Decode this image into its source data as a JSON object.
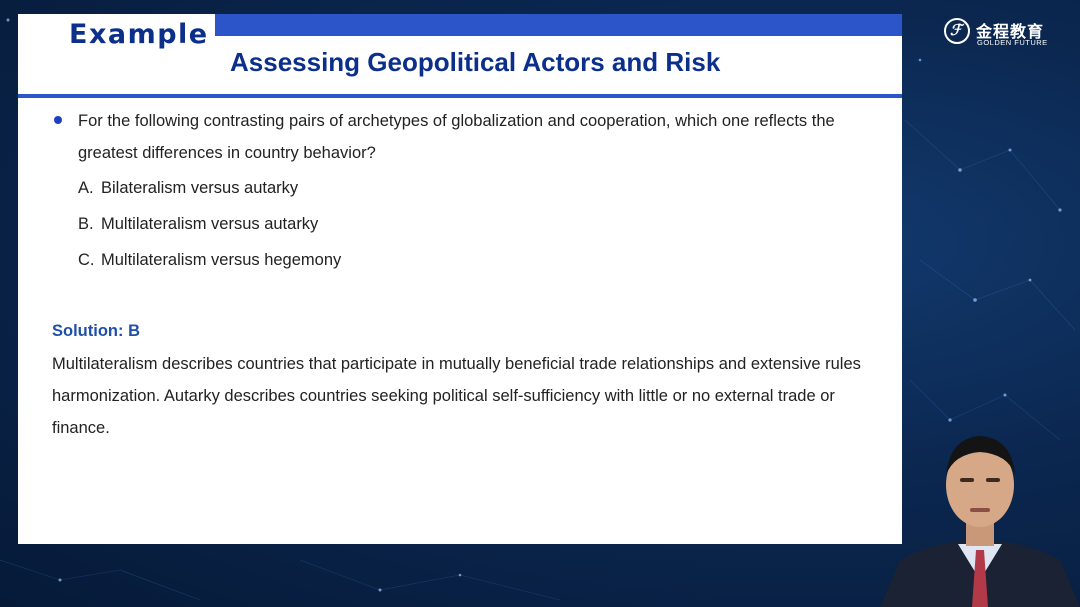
{
  "slide": {
    "tab_label": "Example",
    "title": "Assessing Geopolitical Actors and Risk",
    "question_lines": [
      "For the following contrasting pairs of archetypes of globalization and cooperation, which one reflects the",
      "greatest differences in country behavior?"
    ],
    "options": [
      {
        "letter": "A.",
        "text": "Bilateralism versus autarky"
      },
      {
        "letter": "B.",
        "text": "Multilateralism versus autarky"
      },
      {
        "letter": "C.",
        "text": "Multilateralism versus hegemony"
      }
    ],
    "solution_label": "Solution: B",
    "solution_lines": [
      "Multilateralism describes countries that participate in mutually beneficial trade relationships and extensive rules",
      "harmonization. Autarky describes countries seeking political self-sufficiency with little or no external trade or",
      "finance."
    ]
  },
  "logo": {
    "chinese": "金程教育",
    "english": "GOLDEN FUTURE",
    "glyph": "ℱ"
  },
  "colors": {
    "accent_blue": "#2b55c8",
    "title_navy": "#0b2f8a",
    "solution_blue": "#1f4fa8",
    "background": "#0b2750"
  }
}
